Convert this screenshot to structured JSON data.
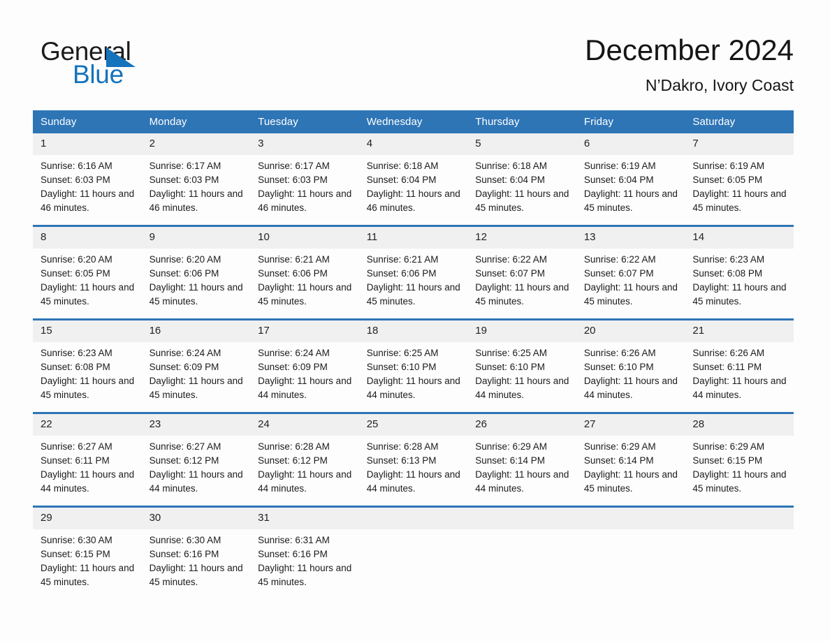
{
  "brand": {
    "word_one": "General",
    "word_two": "Blue",
    "triangle_icon": "brand-triangle-icon"
  },
  "header": {
    "month_title": "December 2024",
    "location": "N’Dakro, Ivory Coast"
  },
  "colors": {
    "header_blue": "#2e75b6",
    "brand_blue": "#1573bc",
    "daynum_band": "#f0f0f0",
    "page_background": "#fdfdfd",
    "text": "#1b1b1b"
  },
  "calendar": {
    "weekday_headers": [
      "Sunday",
      "Monday",
      "Tuesday",
      "Wednesday",
      "Thursday",
      "Friday",
      "Saturday"
    ],
    "weeks": [
      [
        {
          "day": "1",
          "sunrise": "Sunrise: 6:16 AM",
          "sunset": "Sunset: 6:03 PM",
          "daylight": "Daylight: 11 hours and 46 minutes."
        },
        {
          "day": "2",
          "sunrise": "Sunrise: 6:17 AM",
          "sunset": "Sunset: 6:03 PM",
          "daylight": "Daylight: 11 hours and 46 minutes."
        },
        {
          "day": "3",
          "sunrise": "Sunrise: 6:17 AM",
          "sunset": "Sunset: 6:03 PM",
          "daylight": "Daylight: 11 hours and 46 minutes."
        },
        {
          "day": "4",
          "sunrise": "Sunrise: 6:18 AM",
          "sunset": "Sunset: 6:04 PM",
          "daylight": "Daylight: 11 hours and 46 minutes."
        },
        {
          "day": "5",
          "sunrise": "Sunrise: 6:18 AM",
          "sunset": "Sunset: 6:04 PM",
          "daylight": "Daylight: 11 hours and 45 minutes."
        },
        {
          "day": "6",
          "sunrise": "Sunrise: 6:19 AM",
          "sunset": "Sunset: 6:04 PM",
          "daylight": "Daylight: 11 hours and 45 minutes."
        },
        {
          "day": "7",
          "sunrise": "Sunrise: 6:19 AM",
          "sunset": "Sunset: 6:05 PM",
          "daylight": "Daylight: 11 hours and 45 minutes."
        }
      ],
      [
        {
          "day": "8",
          "sunrise": "Sunrise: 6:20 AM",
          "sunset": "Sunset: 6:05 PM",
          "daylight": "Daylight: 11 hours and 45 minutes."
        },
        {
          "day": "9",
          "sunrise": "Sunrise: 6:20 AM",
          "sunset": "Sunset: 6:06 PM",
          "daylight": "Daylight: 11 hours and 45 minutes."
        },
        {
          "day": "10",
          "sunrise": "Sunrise: 6:21 AM",
          "sunset": "Sunset: 6:06 PM",
          "daylight": "Daylight: 11 hours and 45 minutes."
        },
        {
          "day": "11",
          "sunrise": "Sunrise: 6:21 AM",
          "sunset": "Sunset: 6:06 PM",
          "daylight": "Daylight: 11 hours and 45 minutes."
        },
        {
          "day": "12",
          "sunrise": "Sunrise: 6:22 AM",
          "sunset": "Sunset: 6:07 PM",
          "daylight": "Daylight: 11 hours and 45 minutes."
        },
        {
          "day": "13",
          "sunrise": "Sunrise: 6:22 AM",
          "sunset": "Sunset: 6:07 PM",
          "daylight": "Daylight: 11 hours and 45 minutes."
        },
        {
          "day": "14",
          "sunrise": "Sunrise: 6:23 AM",
          "sunset": "Sunset: 6:08 PM",
          "daylight": "Daylight: 11 hours and 45 minutes."
        }
      ],
      [
        {
          "day": "15",
          "sunrise": "Sunrise: 6:23 AM",
          "sunset": "Sunset: 6:08 PM",
          "daylight": "Daylight: 11 hours and 45 minutes."
        },
        {
          "day": "16",
          "sunrise": "Sunrise: 6:24 AM",
          "sunset": "Sunset: 6:09 PM",
          "daylight": "Daylight: 11 hours and 45 minutes."
        },
        {
          "day": "17",
          "sunrise": "Sunrise: 6:24 AM",
          "sunset": "Sunset: 6:09 PM",
          "daylight": "Daylight: 11 hours and 44 minutes."
        },
        {
          "day": "18",
          "sunrise": "Sunrise: 6:25 AM",
          "sunset": "Sunset: 6:10 PM",
          "daylight": "Daylight: 11 hours and 44 minutes."
        },
        {
          "day": "19",
          "sunrise": "Sunrise: 6:25 AM",
          "sunset": "Sunset: 6:10 PM",
          "daylight": "Daylight: 11 hours and 44 minutes."
        },
        {
          "day": "20",
          "sunrise": "Sunrise: 6:26 AM",
          "sunset": "Sunset: 6:10 PM",
          "daylight": "Daylight: 11 hours and 44 minutes."
        },
        {
          "day": "21",
          "sunrise": "Sunrise: 6:26 AM",
          "sunset": "Sunset: 6:11 PM",
          "daylight": "Daylight: 11 hours and 44 minutes."
        }
      ],
      [
        {
          "day": "22",
          "sunrise": "Sunrise: 6:27 AM",
          "sunset": "Sunset: 6:11 PM",
          "daylight": "Daylight: 11 hours and 44 minutes."
        },
        {
          "day": "23",
          "sunrise": "Sunrise: 6:27 AM",
          "sunset": "Sunset: 6:12 PM",
          "daylight": "Daylight: 11 hours and 44 minutes."
        },
        {
          "day": "24",
          "sunrise": "Sunrise: 6:28 AM",
          "sunset": "Sunset: 6:12 PM",
          "daylight": "Daylight: 11 hours and 44 minutes."
        },
        {
          "day": "25",
          "sunrise": "Sunrise: 6:28 AM",
          "sunset": "Sunset: 6:13 PM",
          "daylight": "Daylight: 11 hours and 44 minutes."
        },
        {
          "day": "26",
          "sunrise": "Sunrise: 6:29 AM",
          "sunset": "Sunset: 6:14 PM",
          "daylight": "Daylight: 11 hours and 44 minutes."
        },
        {
          "day": "27",
          "sunrise": "Sunrise: 6:29 AM",
          "sunset": "Sunset: 6:14 PM",
          "daylight": "Daylight: 11 hours and 45 minutes."
        },
        {
          "day": "28",
          "sunrise": "Sunrise: 6:29 AM",
          "sunset": "Sunset: 6:15 PM",
          "daylight": "Daylight: 11 hours and 45 minutes."
        }
      ],
      [
        {
          "day": "29",
          "sunrise": "Sunrise: 6:30 AM",
          "sunset": "Sunset: 6:15 PM",
          "daylight": "Daylight: 11 hours and 45 minutes."
        },
        {
          "day": "30",
          "sunrise": "Sunrise: 6:30 AM",
          "sunset": "Sunset: 6:16 PM",
          "daylight": "Daylight: 11 hours and 45 minutes."
        },
        {
          "day": "31",
          "sunrise": "Sunrise: 6:31 AM",
          "sunset": "Sunset: 6:16 PM",
          "daylight": "Daylight: 11 hours and 45 minutes."
        },
        {
          "day": "",
          "sunrise": "",
          "sunset": "",
          "daylight": ""
        },
        {
          "day": "",
          "sunrise": "",
          "sunset": "",
          "daylight": ""
        },
        {
          "day": "",
          "sunrise": "",
          "sunset": "",
          "daylight": ""
        },
        {
          "day": "",
          "sunrise": "",
          "sunset": "",
          "daylight": ""
        }
      ]
    ]
  }
}
